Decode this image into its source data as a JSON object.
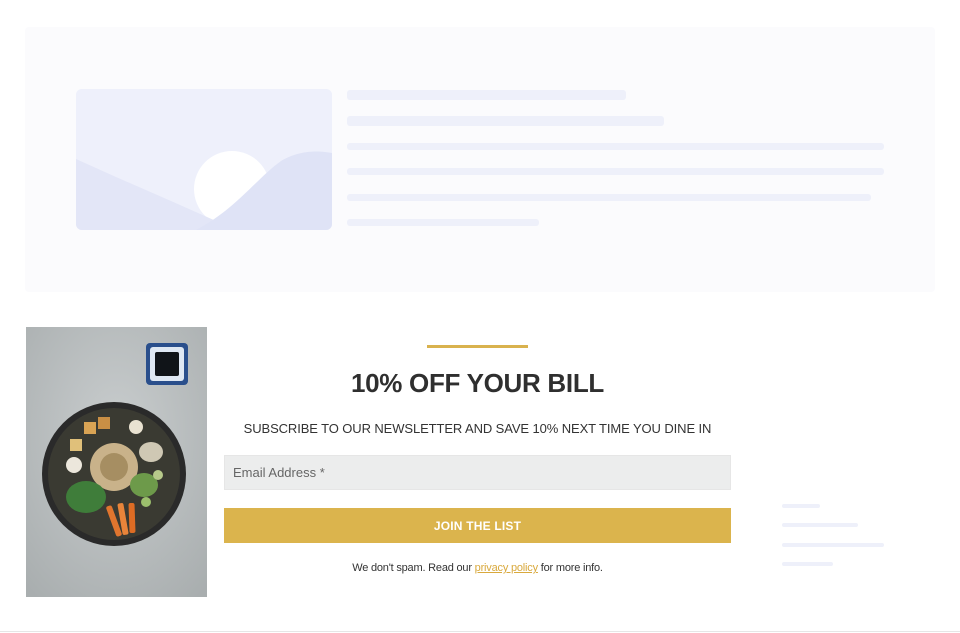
{
  "signup": {
    "headline": "10% OFF YOUR BILL",
    "subtitle": "SUBSCRIBE TO OUR NEWSLETTER AND SAVE 10% NEXT TIME YOU DINE IN",
    "email_placeholder": "Email Address *",
    "join_button_label": "JOIN THE LIST",
    "spam_note_before": "We don't spam. Read our ",
    "privacy_link_label": "privacy policy",
    "spam_note_after": " for more info."
  },
  "colors": {
    "accent": "#dbb44d",
    "skeleton": "#eef0fa",
    "input_background": "#eceded"
  },
  "icons": {
    "placeholder_image": "image-placeholder-icon"
  }
}
